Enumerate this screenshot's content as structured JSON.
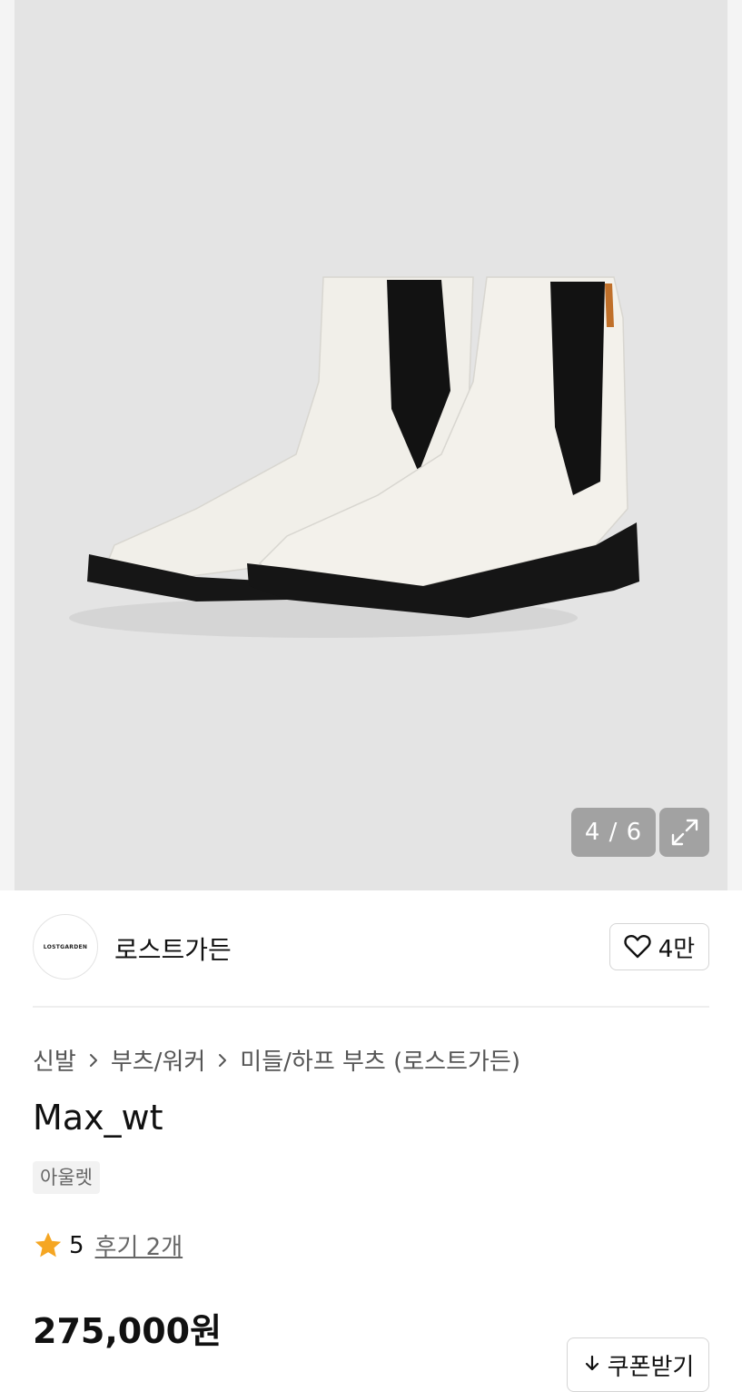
{
  "gallery": {
    "counter": "4 / 6"
  },
  "brand": {
    "logo_text": "LOSTGARDEN",
    "name": "로스트가든",
    "likes": "4만"
  },
  "breadcrumb": {
    "items": [
      "신발",
      "부츠/워커",
      "미들/하프 부츠 (로스트가든)"
    ]
  },
  "product": {
    "title": "Max_wt",
    "badge": "아울렛",
    "rating": "5",
    "reviews": "후기 2개",
    "price": "275,000원"
  },
  "actions": {
    "coupon_label": "쿠폰받기"
  },
  "icons": {
    "expand": "expand-icon",
    "heart": "heart-icon",
    "chevron": "chevron-right-icon",
    "star": "star-icon",
    "download": "download-icon"
  },
  "colors": {
    "star": "#F5A623",
    "image_background": "#E4E4E4",
    "counter_background": "#969696"
  }
}
